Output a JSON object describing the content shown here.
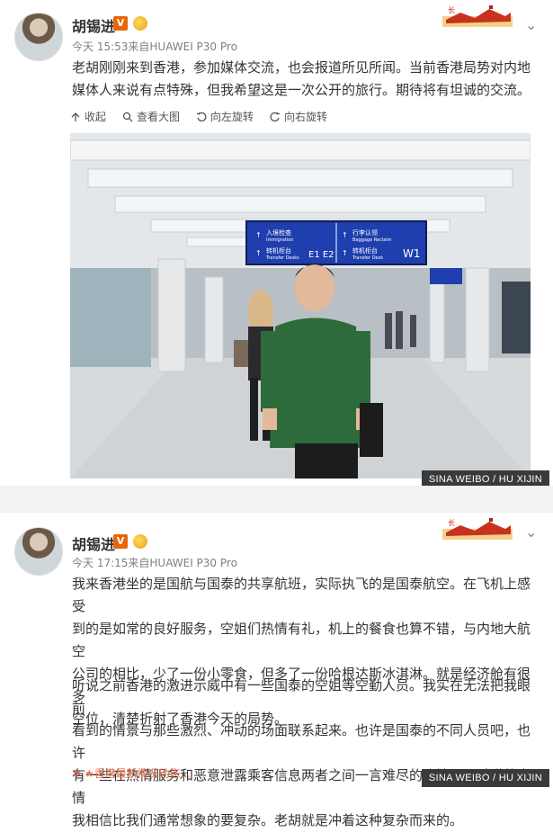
{
  "post1": {
    "author": "胡锡进",
    "v_badge": "V",
    "meta": "今天 15:53来自HUAWEI P30 Pro",
    "text": "老胡刚刚来到香港，参加媒体交流，也会报道所见所闻。当前香港局势对内地媒体人来说有点特殊，但我希望这是一次公开的旅行。期待将有坦诚的交流。",
    "actions": [
      {
        "icon": "collapse-up-icon",
        "label": "收起"
      },
      {
        "icon": "magnifier-icon",
        "label": "查看大图"
      },
      {
        "icon": "rotate-left-icon",
        "label": "向左旋转"
      },
      {
        "icon": "rotate-right-icon",
        "label": "向右旋转"
      }
    ],
    "sign": {
      "line1_left": "入境检查",
      "line1_left_en": "Immigration",
      "line2_left": "转机柜台",
      "line2_left_en": "Transfer Desks",
      "gate_left": "E1 E2",
      "line1_right": "行李认领",
      "line1_right_en": "Baggage Reclaim",
      "line2_right": "转机柜台",
      "line2_right_en": "Transfer Desk",
      "gate_right": "W1"
    },
    "credit": "SINA WEIBO / HU XIJIN"
  },
  "post2": {
    "author": "胡锡进",
    "v_badge": "V",
    "meta": "今天 17:15来自HUAWEI P30 Pro",
    "para1_lines": [
      "我来香港坐的是国航与国泰的共享航班，实际执飞的是国泰航空。在飞机上感受",
      "到的是如常的良好服务，空姐们热情有礼，机上的餐食也算不错，与内地大航空",
      "公司的相比，少了一份小零食，但多了一份哈根达斯冰淇淋。就是经济舱有很多",
      "空位，清楚折射了香港今天的局势。"
    ],
    "para2_lines": [
      "听说之前香港的激进示威中有一些国泰的空姐等空勤人员。我实在无法把我眼前",
      "看到的情景与那些激烈、冲动的场面联系起来。也许是国泰的不同人员吧，也许",
      "有一些在热情服务和恶意泄露乘客信息两者之间一言难尽的隐情吧。香港的事情",
      "我相信比我们通常想象的要复杂。老胡就是冲着这种复杂而来的。"
    ],
    "topic_link": "★香港最新情况动态...",
    "credit": "SINA WEIBO / HU XIJIN"
  },
  "colors": {
    "accent_orange": "#e8650a",
    "link": "#eb7350",
    "sign_blue": "#1f3fae",
    "shirt_green": "#2e6b3a"
  }
}
